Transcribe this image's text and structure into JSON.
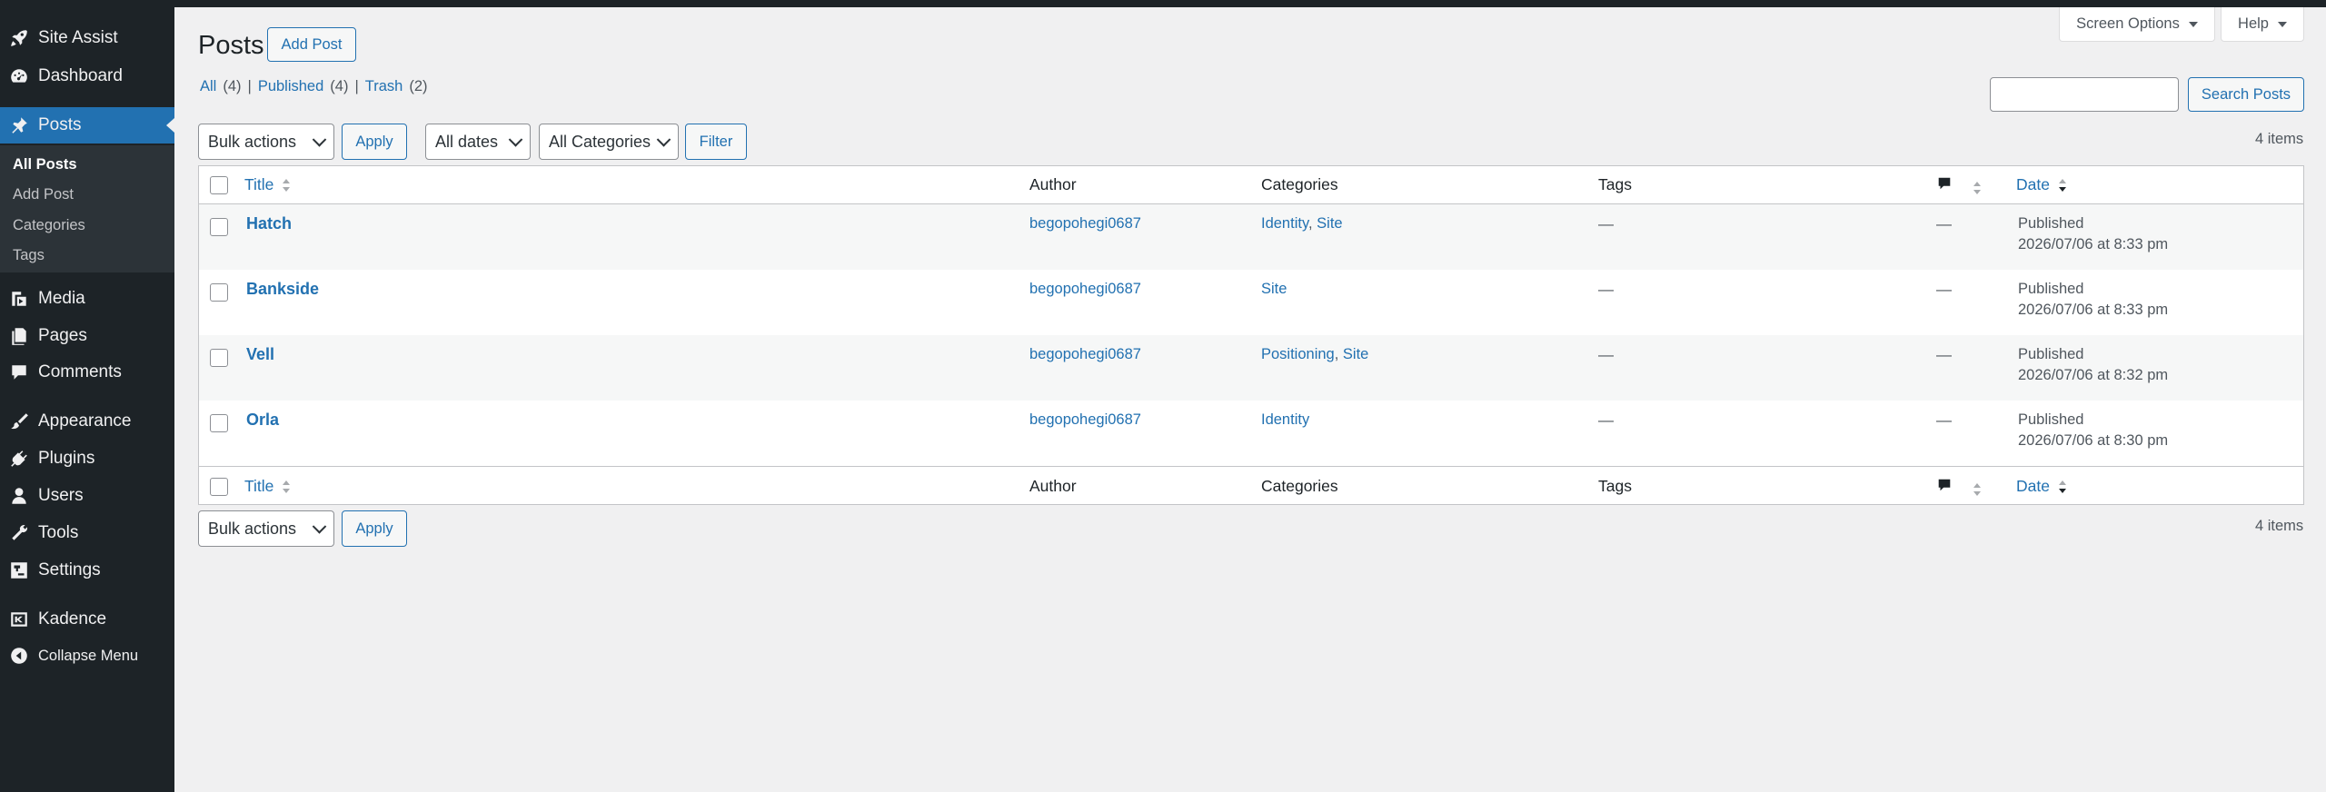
{
  "sidebar": {
    "items": [
      {
        "label": "Site Assist",
        "icon": "rocket-icon"
      },
      {
        "label": "Dashboard",
        "icon": "dashboard-icon"
      },
      {
        "label": "Posts",
        "icon": "pin-icon"
      },
      {
        "label": "Media",
        "icon": "media-icon"
      },
      {
        "label": "Pages",
        "icon": "pages-icon"
      },
      {
        "label": "Comments",
        "icon": "comments-icon"
      },
      {
        "label": "Appearance",
        "icon": "brush-icon"
      },
      {
        "label": "Plugins",
        "icon": "plugin-icon"
      },
      {
        "label": "Users",
        "icon": "user-icon"
      },
      {
        "label": "Tools",
        "icon": "wrench-icon"
      },
      {
        "label": "Settings",
        "icon": "settings-icon"
      },
      {
        "label": "Kadence",
        "icon": "kadence-icon"
      },
      {
        "label": "Collapse Menu",
        "icon": "collapse-icon"
      }
    ],
    "submenu": [
      "All Posts",
      "Add Post",
      "Categories",
      "Tags"
    ]
  },
  "header": {
    "title": "Posts",
    "add_button": "Add Post",
    "screen_options": "Screen Options",
    "help": "Help"
  },
  "views": {
    "all_label": "All",
    "all_count": "(4)",
    "published_label": "Published",
    "published_count": "(4)",
    "trash_label": "Trash",
    "trash_count": "(2)",
    "sep": "|"
  },
  "search": {
    "button": "Search Posts",
    "value": ""
  },
  "filters": {
    "bulk_actions": "Bulk actions",
    "apply": "Apply",
    "dates": "All dates",
    "categories": "All Categories",
    "filter": "Filter"
  },
  "items_count": "4 items",
  "table": {
    "columns": {
      "title": "Title",
      "author": "Author",
      "categories": "Categories",
      "tags": "Tags",
      "date": "Date"
    },
    "rows": [
      {
        "title": "Hatch",
        "author": "begopohegi0687",
        "categories": [
          "Identity",
          "Site"
        ],
        "tags": "—",
        "comments": "—",
        "status": "Published",
        "date": "2026/07/06 at 8:33 pm"
      },
      {
        "title": "Bankside",
        "author": "begopohegi0687",
        "categories": [
          "Site"
        ],
        "tags": "—",
        "comments": "—",
        "status": "Published",
        "date": "2026/07/06 at 8:33 pm"
      },
      {
        "title": "Vell",
        "author": "begopohegi0687",
        "categories": [
          "Positioning",
          "Site"
        ],
        "tags": "—",
        "comments": "—",
        "status": "Published",
        "date": "2026/07/06 at 8:32 pm"
      },
      {
        "title": "Orla",
        "author": "begopohegi0687",
        "categories": [
          "Identity"
        ],
        "tags": "—",
        "comments": "—",
        "status": "Published",
        "date": "2026/07/06 at 8:30 pm"
      }
    ]
  },
  "colors": {
    "accent": "#2271b1",
    "sidebar_bg": "#1d2327",
    "active_menu": "#2271b1"
  }
}
